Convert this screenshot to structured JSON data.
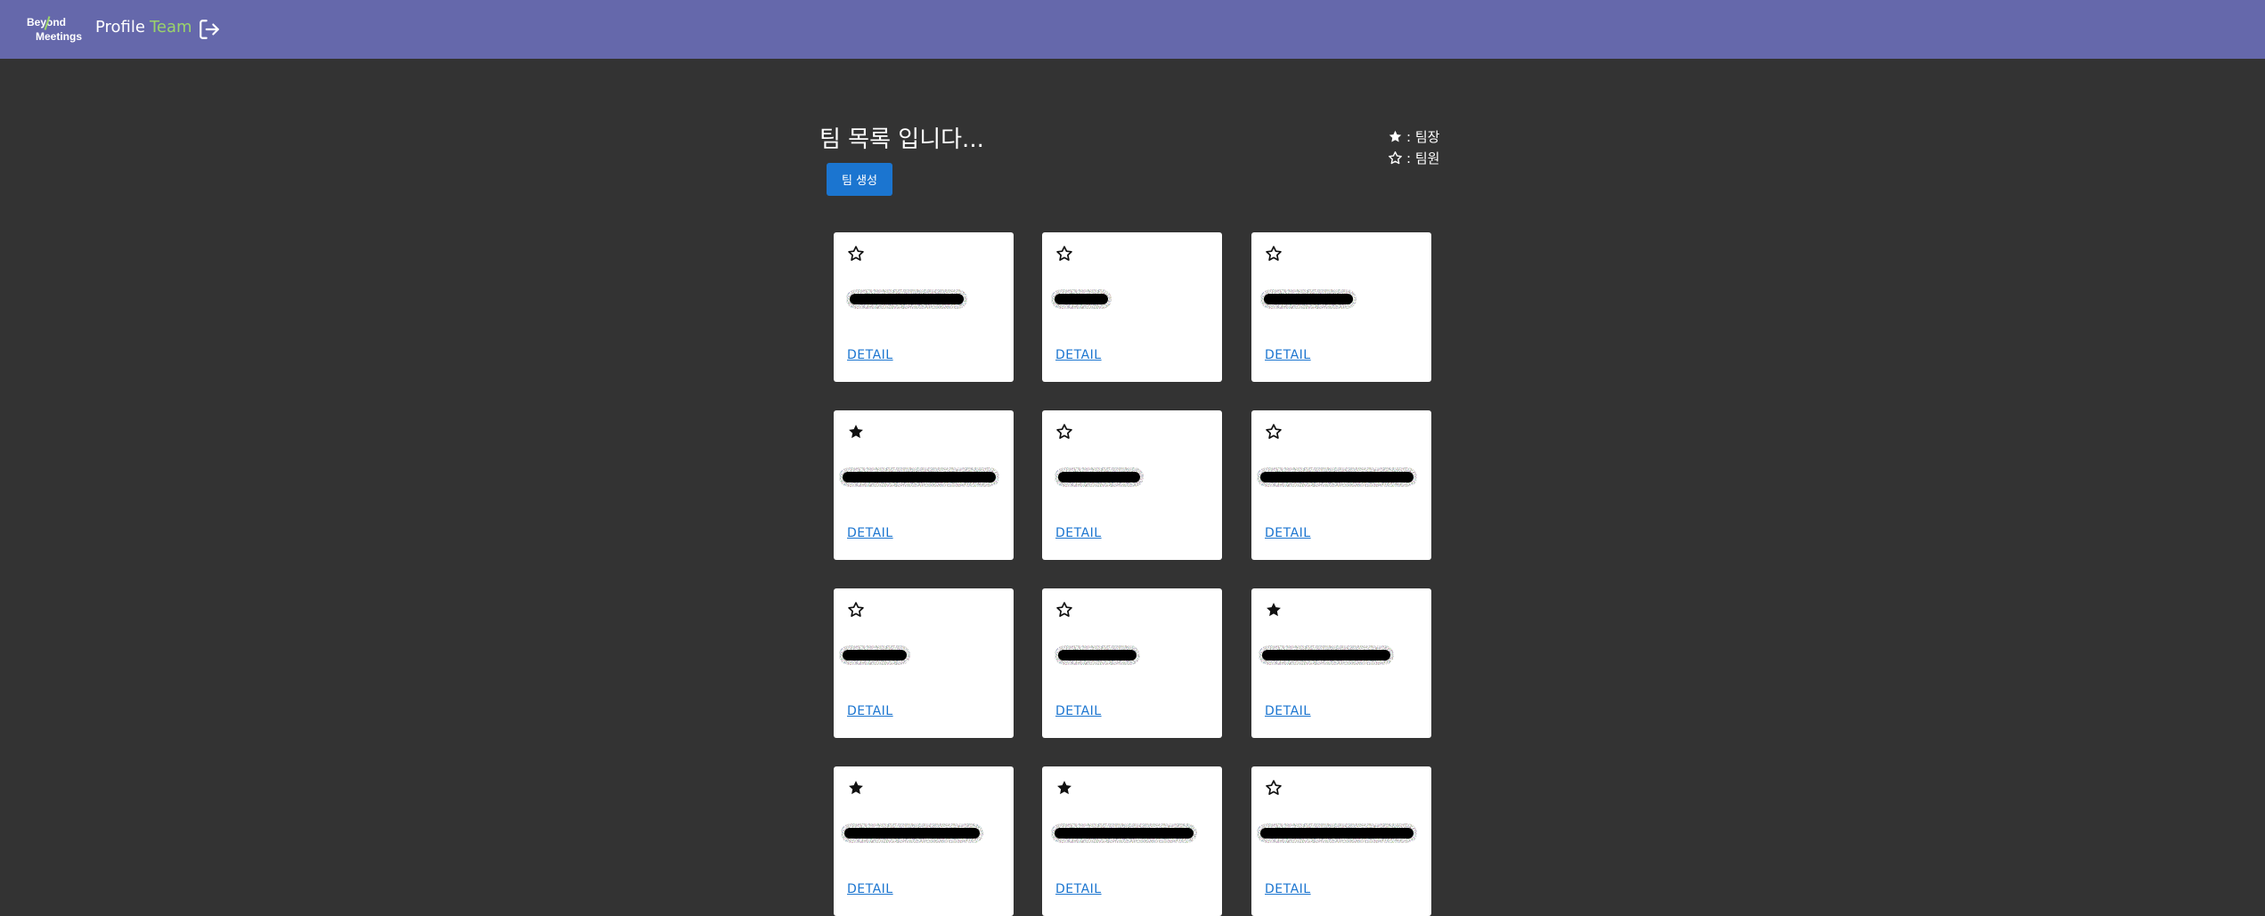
{
  "nav": {
    "logo_line1": "Beyond",
    "logo_line2": "Meetings",
    "profile": "Profile",
    "team": "Team",
    "logout_icon": "logout-icon"
  },
  "colors": {
    "navbar": "#6568ab",
    "background": "#333333",
    "accent_green": "#9bd46a",
    "button_blue": "#1b75d0"
  },
  "page": {
    "title": "팀 목록 입니다...",
    "create_button": "팀 생성"
  },
  "legend": {
    "leader": ": 팀장",
    "member": ": 팀원"
  },
  "teams": [
    {
      "role": "member",
      "detail": "DETAIL"
    },
    {
      "role": "member",
      "detail": "DETAIL"
    },
    {
      "role": "member",
      "detail": "DETAIL"
    },
    {
      "role": "leader",
      "detail": "DETAIL"
    },
    {
      "role": "member",
      "detail": "DETAIL"
    },
    {
      "role": "member",
      "detail": "DETAIL"
    },
    {
      "role": "member",
      "detail": "DETAIL"
    },
    {
      "role": "member",
      "detail": "DETAIL"
    },
    {
      "role": "leader",
      "detail": "DETAIL"
    },
    {
      "role": "leader",
      "detail": "DETAIL"
    },
    {
      "role": "leader",
      "detail": "DETAIL"
    },
    {
      "role": "member",
      "detail": "DETAIL"
    }
  ]
}
